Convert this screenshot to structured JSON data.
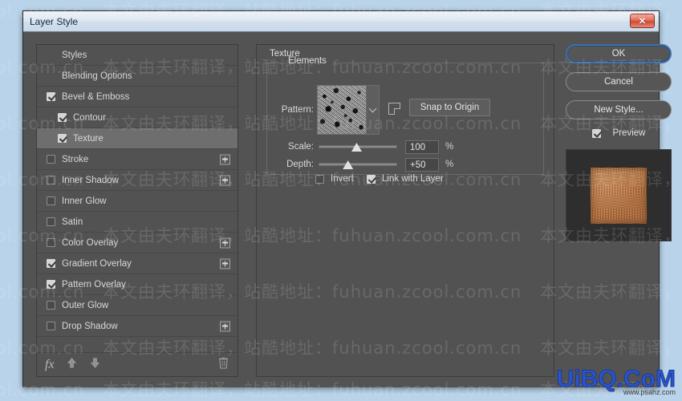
{
  "window": {
    "title": "Layer Style",
    "close_label": "✕"
  },
  "colors": {
    "desktop": "#b9d4ea",
    "dialog_bg": "#535353",
    "panel_bg": "#525252",
    "selected_row": "#6e6e6e",
    "accent_focus": "#3f6fa8",
    "close_red": "#cf4a33",
    "preview_swatch": "#cf7a39"
  },
  "watermark": {
    "text": "本文由夫环翻译，站酷地址：fuhuan.zcool.com.cn",
    "site_logo": "UiBQ.CoM",
    "site_sub": "www.psahz.com"
  },
  "styles_panel": {
    "rows": [
      {
        "label": "Styles",
        "checkbox": "none",
        "indent": false,
        "selected": false,
        "plus": false
      },
      {
        "label": "Blending Options",
        "checkbox": "none",
        "indent": false,
        "selected": false,
        "plus": false
      },
      {
        "label": "Bevel & Emboss",
        "checkbox": "checked",
        "indent": false,
        "selected": false,
        "plus": false
      },
      {
        "label": "Contour",
        "checkbox": "checked",
        "indent": true,
        "selected": false,
        "plus": false
      },
      {
        "label": "Texture",
        "checkbox": "checked",
        "indent": true,
        "selected": true,
        "plus": false
      },
      {
        "label": "Stroke",
        "checkbox": "unchecked",
        "indent": false,
        "selected": false,
        "plus": true
      },
      {
        "label": "Inner Shadow",
        "checkbox": "unchecked",
        "indent": false,
        "selected": false,
        "plus": true
      },
      {
        "label": "Inner Glow",
        "checkbox": "unchecked",
        "indent": false,
        "selected": false,
        "plus": false
      },
      {
        "label": "Satin",
        "checkbox": "unchecked",
        "indent": false,
        "selected": false,
        "plus": false
      },
      {
        "label": "Color Overlay",
        "checkbox": "unchecked",
        "indent": false,
        "selected": false,
        "plus": true
      },
      {
        "label": "Gradient Overlay",
        "checkbox": "checked",
        "indent": false,
        "selected": false,
        "plus": true
      },
      {
        "label": "Pattern Overlay",
        "checkbox": "checked",
        "indent": false,
        "selected": false,
        "plus": false
      },
      {
        "label": "Outer Glow",
        "checkbox": "unchecked",
        "indent": false,
        "selected": false,
        "plus": false
      },
      {
        "label": "Drop Shadow",
        "checkbox": "unchecked",
        "indent": false,
        "selected": false,
        "plus": true
      }
    ],
    "footer": {
      "fx_label": "fx",
      "move_up_icon": "arrow-up-icon",
      "move_down_icon": "arrow-down-icon",
      "delete_icon": "trash-icon"
    }
  },
  "texture": {
    "panel_title": "Texture",
    "group_label": "Elements",
    "pattern_label": "Pattern:",
    "pattern_swatch_icon": "pattern-thumbnail",
    "pattern_dropdown_icon": "chevron-down-icon",
    "new_preset_icon": "new-preset-icon",
    "snap_button": "Snap to Origin",
    "scale": {
      "label": "Scale:",
      "value": "100",
      "unit": "%",
      "min": 1,
      "max": 1000,
      "thumb_pct": 48
    },
    "depth": {
      "label": "Depth:",
      "value": "+50",
      "unit": "%",
      "min": -1000,
      "max": 1000,
      "thumb_pct": 37
    },
    "invert": {
      "label": "Invert",
      "checked": false
    },
    "link_with_layer": {
      "label": "Link with Layer",
      "checked": true
    }
  },
  "buttons": {
    "ok": "OK",
    "cancel": "Cancel",
    "new_style": "New Style...",
    "preview": {
      "label": "Preview",
      "checked": true
    }
  }
}
